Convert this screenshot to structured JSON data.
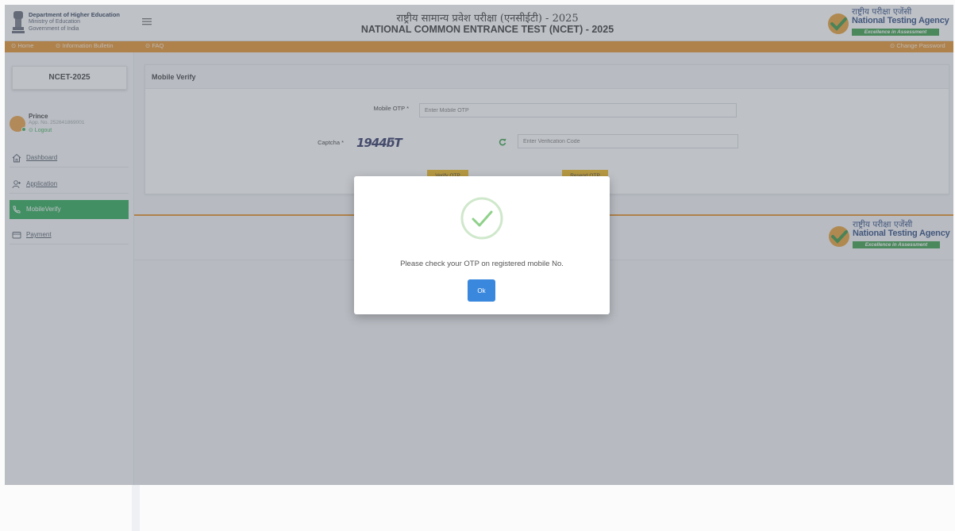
{
  "header": {
    "dept_line1": "Department of Higher Education",
    "dept_line2": "Ministry of Education",
    "dept_line3": "Government of India",
    "title_hindi": "राष्ट्रीय सामान्य प्रवेश परीक्षा (एनसीईटी) - 2025",
    "title_english": "NATIONAL COMMON ENTRANCE TEST (NCET) - 2025",
    "nta_hindi": "राष्ट्रीय परीक्षा एजेंसी",
    "nta_english": "National Testing Agency",
    "nta_tagline": "Excellence in Assessment"
  },
  "navbar": {
    "home": "⊙ Home",
    "bulletin": "⊙ Information Bulletin",
    "faq": "⊙ FAQ",
    "change_password": "⊙ Change Password"
  },
  "sidebar": {
    "exam_label": "NCET-2025",
    "user_name": "Prince",
    "app_no": "App. No. 252641869001",
    "logout": "⊙ Logout",
    "items": [
      {
        "label": "Dashboard",
        "icon": "home-icon"
      },
      {
        "label": "Application",
        "icon": "user-add-icon"
      },
      {
        "label": "MobileVerify",
        "icon": "phone-icon",
        "active": true
      },
      {
        "label": "Payment",
        "icon": "card-icon"
      }
    ]
  },
  "main": {
    "card_title": "Mobile Verify",
    "otp_label": "Mobile OTP *",
    "otp_placeholder": "Enter Mobile OTP",
    "captcha_label": "Captcha *",
    "captcha_text": "1944ƃT",
    "captcha_placeholder": "Enter Verification Code",
    "verify_button": "Verify OTP",
    "resend_button": "Resend OTP"
  },
  "modal": {
    "message": "Please check your OTP on registered mobile No.",
    "ok_label": "Ok",
    "icon": "success-check-icon"
  },
  "colors": {
    "nav_orange": "#e38b1f",
    "active_green": "#1ea54b",
    "button_yellow": "#f1b40f",
    "ok_blue": "#3a88dd",
    "success_green": "#8fd18a"
  }
}
